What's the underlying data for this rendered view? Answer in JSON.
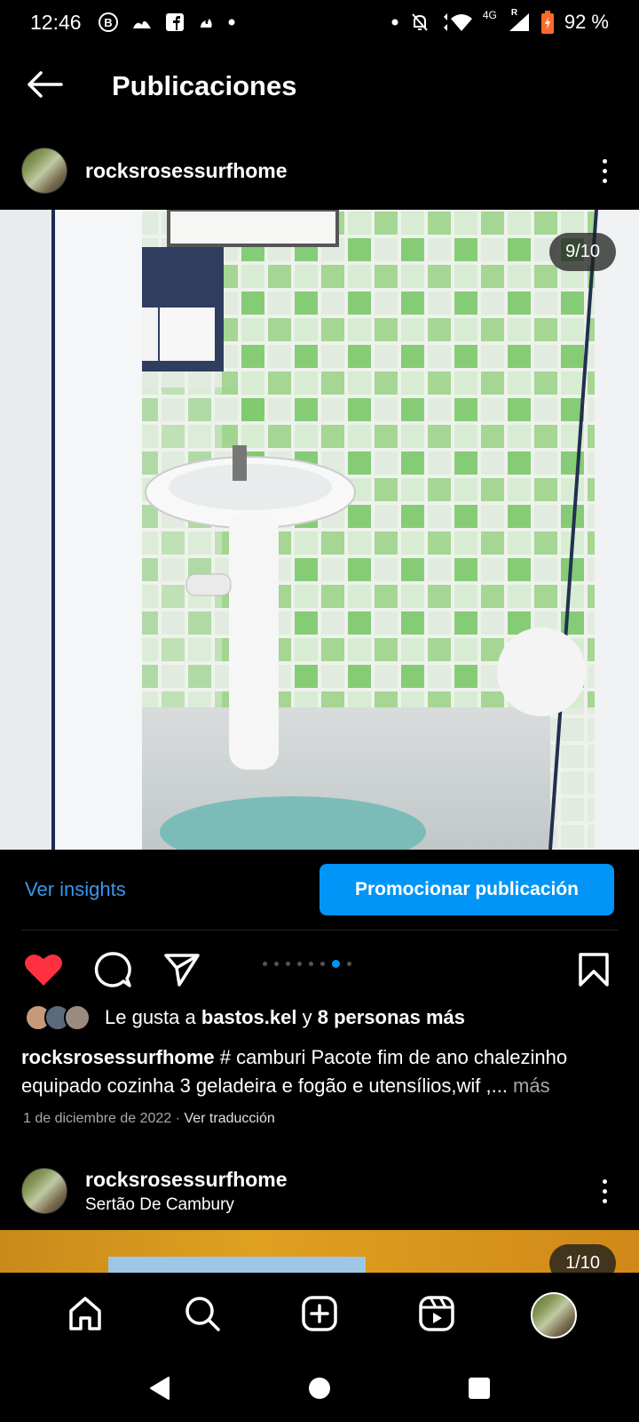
{
  "status_bar": {
    "time": "12:46",
    "network": "4G",
    "roaming": "R",
    "battery": "92 %",
    "left_icons": [
      "bitcoin-icon",
      "fire-icon",
      "facebook-icon",
      "flame-icon",
      "dot-icon"
    ],
    "right_icons": [
      "dot-icon",
      "mute-bell-icon",
      "wifi-icon",
      "signal-icon",
      "battery-icon"
    ]
  },
  "header": {
    "title": "Publicaciones",
    "back_icon": "arrow-left-icon"
  },
  "post": {
    "username": "rocksrosessurfhome",
    "image_counter": "9/10",
    "insights_label": "Ver insights",
    "promote_label": "Promocionar publicación",
    "likes": {
      "prefix": "Le gusta a ",
      "user": "bastos.kel",
      "joiner": " y ",
      "others": "8 personas más"
    },
    "caption_user": "rocksrosessurfhome",
    "caption_text": " # camburi Pacote fim de ano chalezinho equipado cozinha 3 geladeira e fogão e utensílios,wif ,...",
    "caption_more": " más",
    "date": "1 de diciembre de 2022",
    "separator": " · ",
    "translate_label": "Ver traducción",
    "carousel_total": 10,
    "carousel_active": 9
  },
  "next_post": {
    "username": "rocksrosessurfhome",
    "location": "Sertão De Cambury",
    "image_counter": "1/10"
  },
  "bottom_nav": [
    "home-icon",
    "search-icon",
    "add-post-icon",
    "reels-icon",
    "profile-avatar"
  ],
  "system_nav": [
    "back-triangle-icon",
    "home-circle-icon",
    "recents-square-icon"
  ],
  "colors": {
    "accent": "#0095f6",
    "link": "#3897f0",
    "like": "#ff3040",
    "background": "#000000"
  }
}
